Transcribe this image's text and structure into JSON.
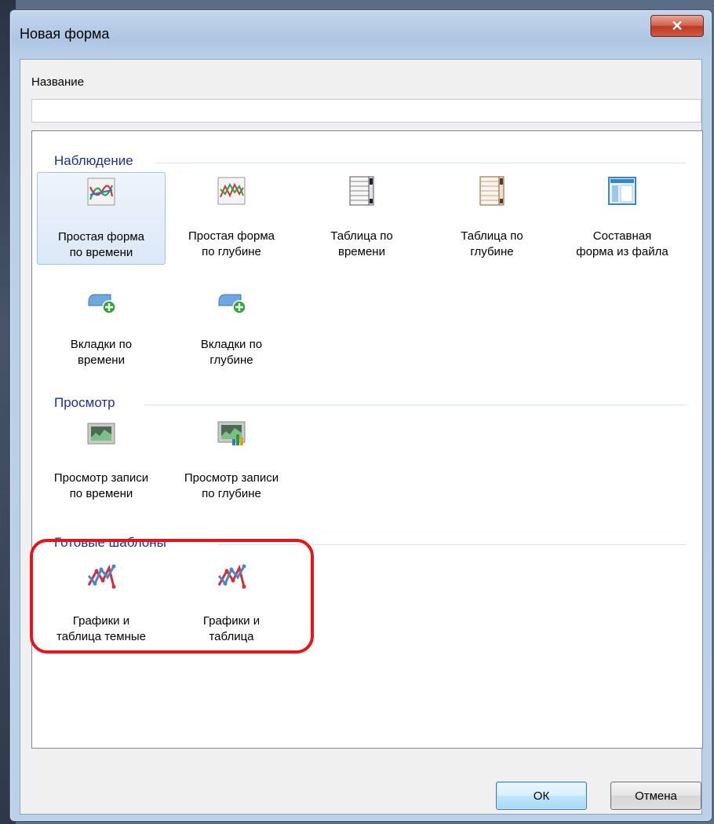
{
  "window": {
    "title": "Новая форма",
    "close_glyph": "✕"
  },
  "name_field": {
    "label": "Название",
    "value": ""
  },
  "sections": [
    {
      "title": "Наблюдение",
      "items": [
        {
          "label": "Простая форма\nпо времени",
          "icon": "line-chart-icon",
          "selected": true
        },
        {
          "label": "Простая форма\nпо глубине",
          "icon": "depth-chart-icon"
        },
        {
          "label": "Таблица по\nвремени",
          "icon": "table-scroll-icon"
        },
        {
          "label": "Таблица по\nглубине",
          "icon": "table-scroll-brown-icon"
        },
        {
          "label": "Составная\nформа из файла",
          "icon": "window-layout-icon"
        },
        {
          "label": "Вкладки по\nвремени",
          "icon": "tab-add-icon"
        },
        {
          "label": "Вкладки по\nглубине",
          "icon": "tab-add-icon"
        }
      ]
    },
    {
      "title": "Просмотр",
      "items": [
        {
          "label": "Просмотр записи\nпо времени",
          "icon": "monitor-chart-icon"
        },
        {
          "label": "Просмотр записи\nпо глубине",
          "icon": "monitor-bars-icon"
        }
      ]
    },
    {
      "title": "Готовые шаблоны",
      "items": [
        {
          "label": "Графики и\nтаблица темные",
          "icon": "template-chart-icon"
        },
        {
          "label": "Графики и\nтаблица",
          "icon": "template-chart-icon"
        }
      ]
    }
  ],
  "buttons": {
    "ok": "ОК",
    "cancel": "Отмена"
  },
  "colors": {
    "section_header": "#1e3287",
    "highlight_outline": "#e8141c"
  }
}
